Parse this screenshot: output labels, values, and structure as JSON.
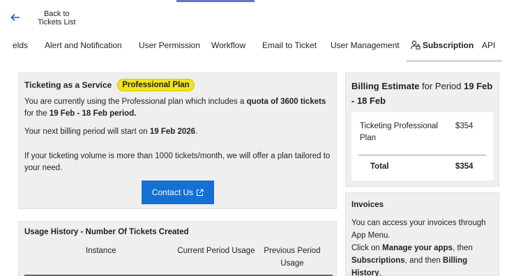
{
  "back": {
    "label_line1": "Back to",
    "label_line2": "Tickets List"
  },
  "tabs": [
    {
      "label": "elds"
    },
    {
      "label": "Alert and Notification"
    },
    {
      "label": "User Permission"
    },
    {
      "label": "Workflow"
    },
    {
      "label": "Email to Ticket"
    },
    {
      "label": "User Management"
    },
    {
      "label": "Subscription",
      "active": true
    },
    {
      "label": "API"
    }
  ],
  "service": {
    "title": "Ticketing as a Service",
    "plan_badge": "Professional Plan",
    "line1_pre": "You are currently using the Professional plan which includes a ",
    "line1_bold": "quota of 3600 tickets",
    "line2_pre": "for the ",
    "line2_bold": "19 Feb - 18 Feb period.",
    "next_billing_pre": "Your next billing period will start on ",
    "next_billing_bold": "19 Feb 2026",
    "next_billing_post": ".",
    "volume_line1": "If your ticketing volume is more than 1000 tickets/month, we will offer a plan tailored to",
    "volume_line2": "your need.",
    "contact_button": "Contact Us"
  },
  "usage": {
    "title": "Usage History - Number Of Tickets Created",
    "columns": [
      "Instance",
      "Current Period Usage",
      "Previous Period",
      "Usage"
    ]
  },
  "billing": {
    "title_bold": "Billing Estimate",
    "title_mid": " for Period ",
    "title_period_a": "19 Feb",
    "title_period_b": "- 18 Feb",
    "item_name_1": "Ticketing Professional",
    "item_name_2": "Plan",
    "item_amount": "$354",
    "total_label": "Total",
    "total_amount": "$354"
  },
  "invoices": {
    "title": "Invoices",
    "t1": "You can access your invoices through",
    "t2": "App Menu.",
    "t3_pre": "Click on ",
    "t3_bold": "Manage your apps",
    "t3_post": ", then",
    "t4_bold1": "Subscriptions",
    "t4_mid": ", and then ",
    "t4_bold2": "Billing History",
    "t4_post": "."
  },
  "colors": {
    "accent": "#1570d3",
    "badge": "#f4e21a",
    "card_bg": "#efefef"
  }
}
